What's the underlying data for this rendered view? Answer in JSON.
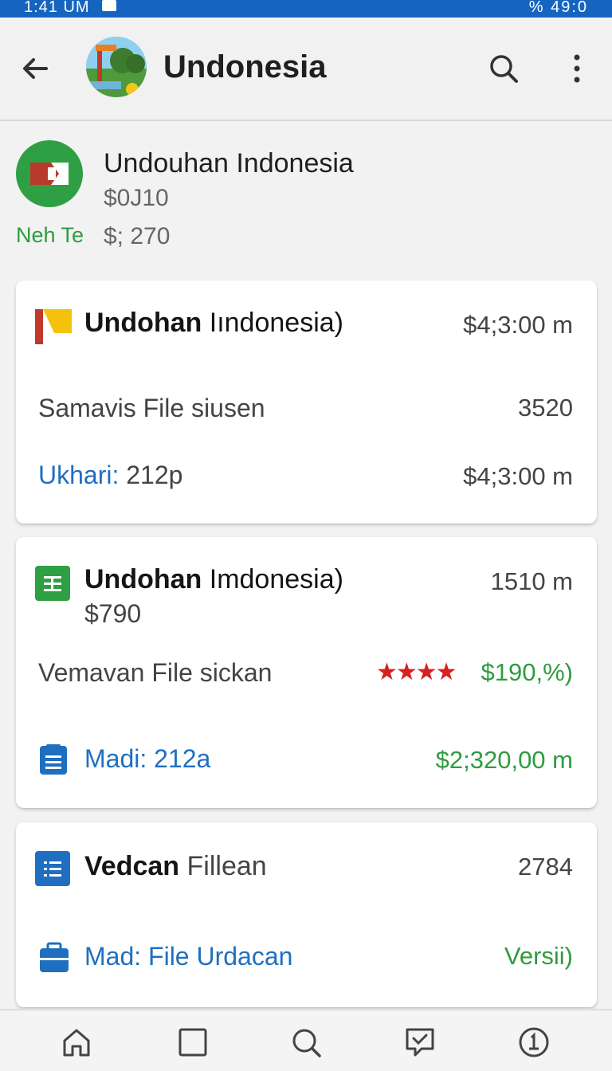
{
  "status_bar": {
    "time": "1:41 UM",
    "right_text": "% 49:0"
  },
  "app_bar": {
    "back_icon": "arrow-left-icon",
    "title": "Undonesia",
    "search_icon": "search-icon",
    "more_icon": "more-vertical-icon"
  },
  "summary": {
    "title": "Undouhan Indonesia",
    "line1": "$0J10",
    "line2": "$; 270",
    "tag": "Neh Te",
    "tag_color": "#2e9c3e"
  },
  "cards": [
    {
      "title_bold": "Undohan",
      "title_rest": " Iındonesia)",
      "title_value": "$4;3:00 m",
      "row1_label": "Samavis File siusen",
      "row1_value": "3520",
      "row2_label_blue": "Ukhari:",
      "row2_label_rest": " 212p",
      "row2_value": "$4;3:00 m"
    },
    {
      "title_bold": "Undohan",
      "title_rest": " Imdonesia)",
      "title_value": "1510 m",
      "subtitle": "$790",
      "row1_label": "Vemavan File sickan",
      "rating_stars": 4,
      "row1_value": "$190,%)",
      "row2_label": "Madi: 212a",
      "row2_value": "$2;320,00 m"
    },
    {
      "title_bold": "Vedcan",
      "title_rest": " Fillean",
      "title_value": "2784",
      "row2_label": "Mad: File Urdacan",
      "row2_value": "Versii)"
    }
  ],
  "bottom_nav": [
    "home-icon",
    "square-icon",
    "search-icon",
    "message-icon",
    "account-icon"
  ],
  "colors": {
    "accent_blue": "#1f6fc0",
    "accent_green": "#2e9c3e",
    "star_red": "#d72020",
    "status_bar": "#1565c0"
  }
}
